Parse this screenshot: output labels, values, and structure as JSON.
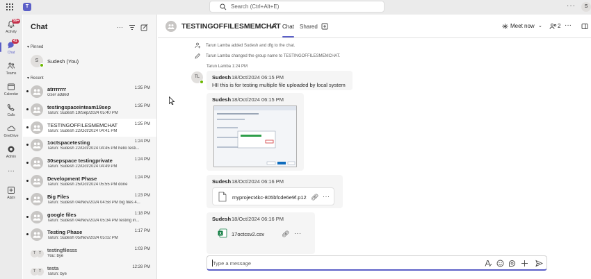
{
  "topbar": {
    "search_placeholder": "Search (Ctrl+Alt+E)",
    "more_label": "···",
    "me_initial": "S"
  },
  "rail": {
    "items": [
      {
        "label": "Activity",
        "badge": "99+"
      },
      {
        "label": "Chat",
        "badge": "41"
      },
      {
        "label": "Teams"
      },
      {
        "label": "Calendar"
      },
      {
        "label": "Calls"
      },
      {
        "label": "OneDrive"
      },
      {
        "label": "Admin"
      },
      {
        "label": "···"
      },
      {
        "label": "Apps"
      }
    ]
  },
  "list": {
    "title": "Chat",
    "pinned_label": "Pinned",
    "recent_label": "Recent",
    "pinned": [
      {
        "name": "Sudesh (You)",
        "initial": "S"
      }
    ],
    "recent": [
      {
        "name": "atrrrrrrr",
        "preview": "User added",
        "time": "1:35 PM"
      },
      {
        "name": "testingspaceinteam19sep",
        "preview": "Tarun: Sudesh 19/Sep/2024 05:40 PM",
        "time": "1:35 PM"
      },
      {
        "name": "TESTINGOFFILESMEMCHAT",
        "preview": "Tarun: Sudesh 22/Oct/2024 04:41 PM",
        "time": "1:25 PM"
      },
      {
        "name": "1octspacetesting",
        "preview": "Tarun: Sudesh 22/Oct/2024 04:45 PM hello testi...",
        "time": "1:24 PM"
      },
      {
        "name": "30sepspace testingprivate",
        "preview": "Tarun: Sudesh 22/Oct/2024 04:49 PM",
        "time": "1:24 PM"
      },
      {
        "name": "Development Phase",
        "preview": "Tarun: Sudesh 25/Oct/2024 05:55 PM done",
        "time": "1:24 PM"
      },
      {
        "name": "Big Files",
        "preview": "Tarun: Sudesh 04/Nov/2024 04:58 PM big files 4...",
        "time": "1:23 PM"
      },
      {
        "name": "google files",
        "preview": "Tarun: Sudesh 04/Nov/2024 05:34 PM testing in...",
        "time": "1:18 PM"
      },
      {
        "name": "Testing Phase",
        "preview": "Tarun: Sudesh 05/Nov/2024 05:02 PM",
        "time": "1:17 PM"
      },
      {
        "name": "testingfilesss",
        "preview": "You: bye",
        "time": "1:03 PM",
        "initials": [
          "T",
          "T"
        ]
      },
      {
        "name": "testa",
        "preview": "Tarun: bye",
        "time": "12:28 PM",
        "initials": [
          "T",
          "T"
        ]
      }
    ]
  },
  "main": {
    "title": "TESTINGOFFILESMEMCHAT",
    "tabs": [
      "Chat",
      "Shared"
    ],
    "meet_now": "Meet now",
    "participants_count": "2",
    "system_messages": [
      "Tarun Lamba added Sudesh and dfg to the chat.",
      "Tarun Lamba changed the group name to TESTINGOFFILESMEMCHAT."
    ],
    "meta_line": "Tarun Lamba   1:24 PM",
    "sender_avatar": "TL",
    "messages": [
      {
        "sender": "Sudesh",
        "time": "18/Oct/2024 06:15 PM",
        "text": "HII this is for testing multiple file uploaded by local system"
      },
      {
        "sender": "Sudesh",
        "time": "18/Oct/2024 06:15 PM"
      },
      {
        "sender": "Sudesh",
        "time": "18/Oct/2024 06:16 PM",
        "file": "myproject4kc-805bfcde6e9f.p12"
      },
      {
        "sender": "Sudesh",
        "time": "18/Oct/2024 06:16 PM",
        "file": "17octcsv2.csv"
      }
    ],
    "composer_placeholder": "Type a message"
  }
}
